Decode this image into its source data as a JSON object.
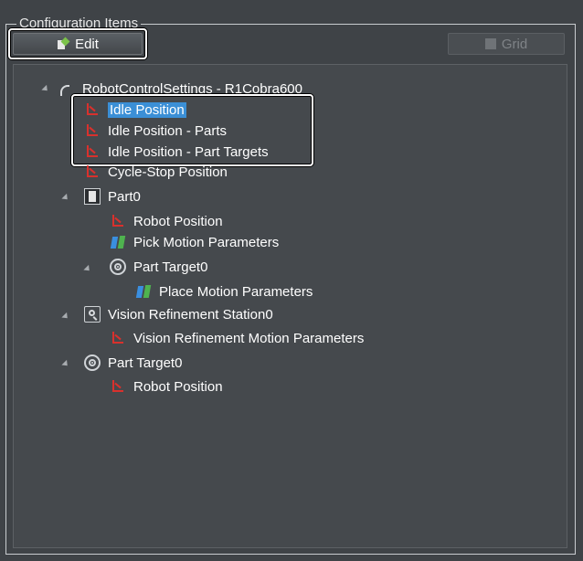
{
  "group": {
    "title": "Configuration Items"
  },
  "toolbar": {
    "edit_label": "Edit",
    "grid_label": "Grid"
  },
  "tree": {
    "nodes": [
      {
        "label": "RobotControlSettings - R1Cobra600",
        "icon": "robot-arm-icon"
      },
      {
        "label": "Idle Position",
        "icon": "coordinate-axes-icon",
        "selected": true
      },
      {
        "label": "Idle Position - Parts",
        "icon": "coordinate-axes-icon"
      },
      {
        "label": "Idle Position - Part Targets",
        "icon": "coordinate-axes-icon"
      },
      {
        "label": "Cycle-Stop Position",
        "icon": "coordinate-axes-icon"
      },
      {
        "label": "Part0",
        "icon": "part-chip-icon"
      },
      {
        "label": "Robot Position",
        "icon": "coordinate-axes-icon"
      },
      {
        "label": "Pick Motion Parameters",
        "icon": "motion-parameters-icon"
      },
      {
        "label": "Part Target0",
        "icon": "part-target-icon"
      },
      {
        "label": "Place Motion Parameters",
        "icon": "motion-parameters-icon"
      },
      {
        "label": "Vision Refinement Station0",
        "icon": "vision-station-icon"
      },
      {
        "label": "Vision Refinement Motion Parameters",
        "icon": "coordinate-axes-icon"
      },
      {
        "label": "Part Target0",
        "icon": "part-target-icon"
      },
      {
        "label": "Robot Position",
        "icon": "coordinate-axes-icon"
      }
    ]
  },
  "colors": {
    "background": "#3f4347",
    "selection": "#3b8fd6",
    "axis_icon": "#d8312d"
  }
}
